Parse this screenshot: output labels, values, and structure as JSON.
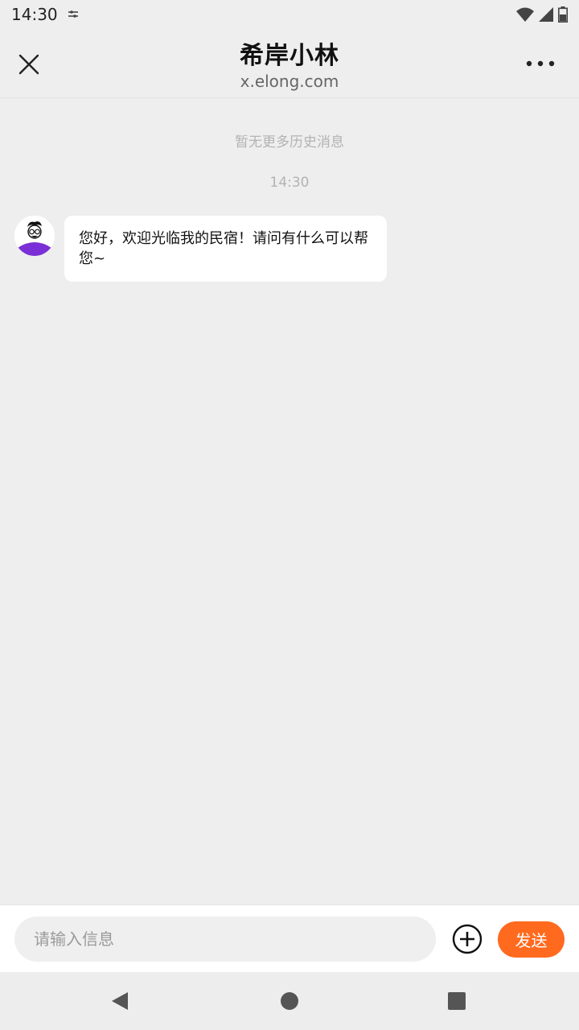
{
  "status_bar": {
    "time": "14:30",
    "icons": [
      "sim-settings-icon",
      "wifi-icon",
      "signal-icon",
      "battery-icon"
    ]
  },
  "header": {
    "title": "希岸小林",
    "subtitle": "x.elong.com",
    "close_icon": "close-icon",
    "more_icon": "more-icon"
  },
  "chat": {
    "history_note": "暂无更多历史消息",
    "timestamp": "14:30",
    "messages": [
      {
        "sender": "host",
        "text": "您好，欢迎光临我的民宿！请问有什么可以帮您~"
      }
    ]
  },
  "input_bar": {
    "placeholder": "请输入信息",
    "value": "",
    "plus_icon": "plus-circle-icon",
    "send_label": "发送"
  },
  "nav_bar": {
    "icons": [
      "back-icon",
      "home-icon",
      "recents-icon"
    ]
  },
  "colors": {
    "accent": "#ff6a1f",
    "background": "#eeeeee",
    "avatar_shirt": "#7b2fd6"
  }
}
